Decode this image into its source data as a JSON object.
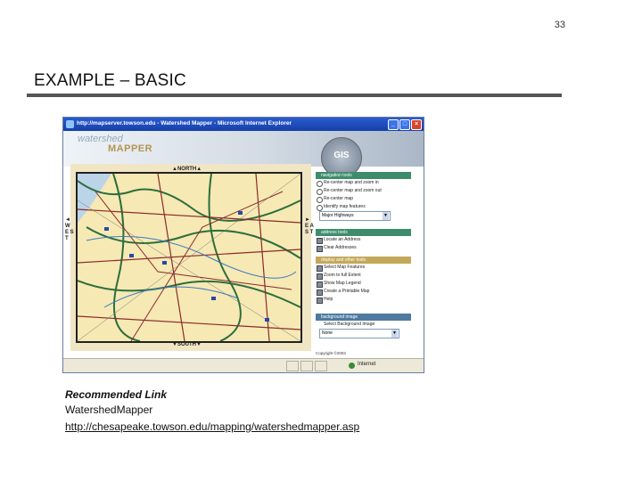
{
  "slide": {
    "page_number": "33",
    "title": "EXAMPLE – BASIC"
  },
  "screenshot": {
    "window_title": "http://mapserver.towson.edu - Watershed Mapper - Microsoft Internet Explorer",
    "logo_top": "watershed",
    "logo_bottom": "MAPPER",
    "gis_badge": "GIS",
    "directions": {
      "north": "▲NORTH▲",
      "south": "▼SOUTH▼",
      "west": "◄ W E S T",
      "east": "► E A S T"
    },
    "panels": {
      "navigation": {
        "title": "navigation tools",
        "options": [
          "Re-center map and zoom in",
          "Re-center map and zoom out",
          "Re-center map",
          "Identify map features"
        ],
        "select_value": "Major Highways"
      },
      "address": {
        "title": "address tools",
        "items": [
          "Locate an Address",
          "Clear Addresses"
        ]
      },
      "display": {
        "title": "display and other tools",
        "items": [
          "Select Map Features",
          "Zoom to full Extent",
          "Show Map Legend",
          "Create a Printable Map",
          "Help"
        ]
      },
      "background": {
        "title": "background image",
        "label": "Select Background Image",
        "select_value": "None"
      }
    },
    "copyright": "Copyright ©2004",
    "status_zone": "Internet",
    "colors": {
      "nav_header": "#3d8c6b",
      "address_header": "#3d8c6b",
      "display_header": "#c4a85a",
      "background_header": "#4f7aa0"
    }
  },
  "link": {
    "label": "Recommended Link",
    "name": "WatershedMapper",
    "url": "http://chesapeake.towson.edu/mapping/watershedmapper.asp"
  }
}
